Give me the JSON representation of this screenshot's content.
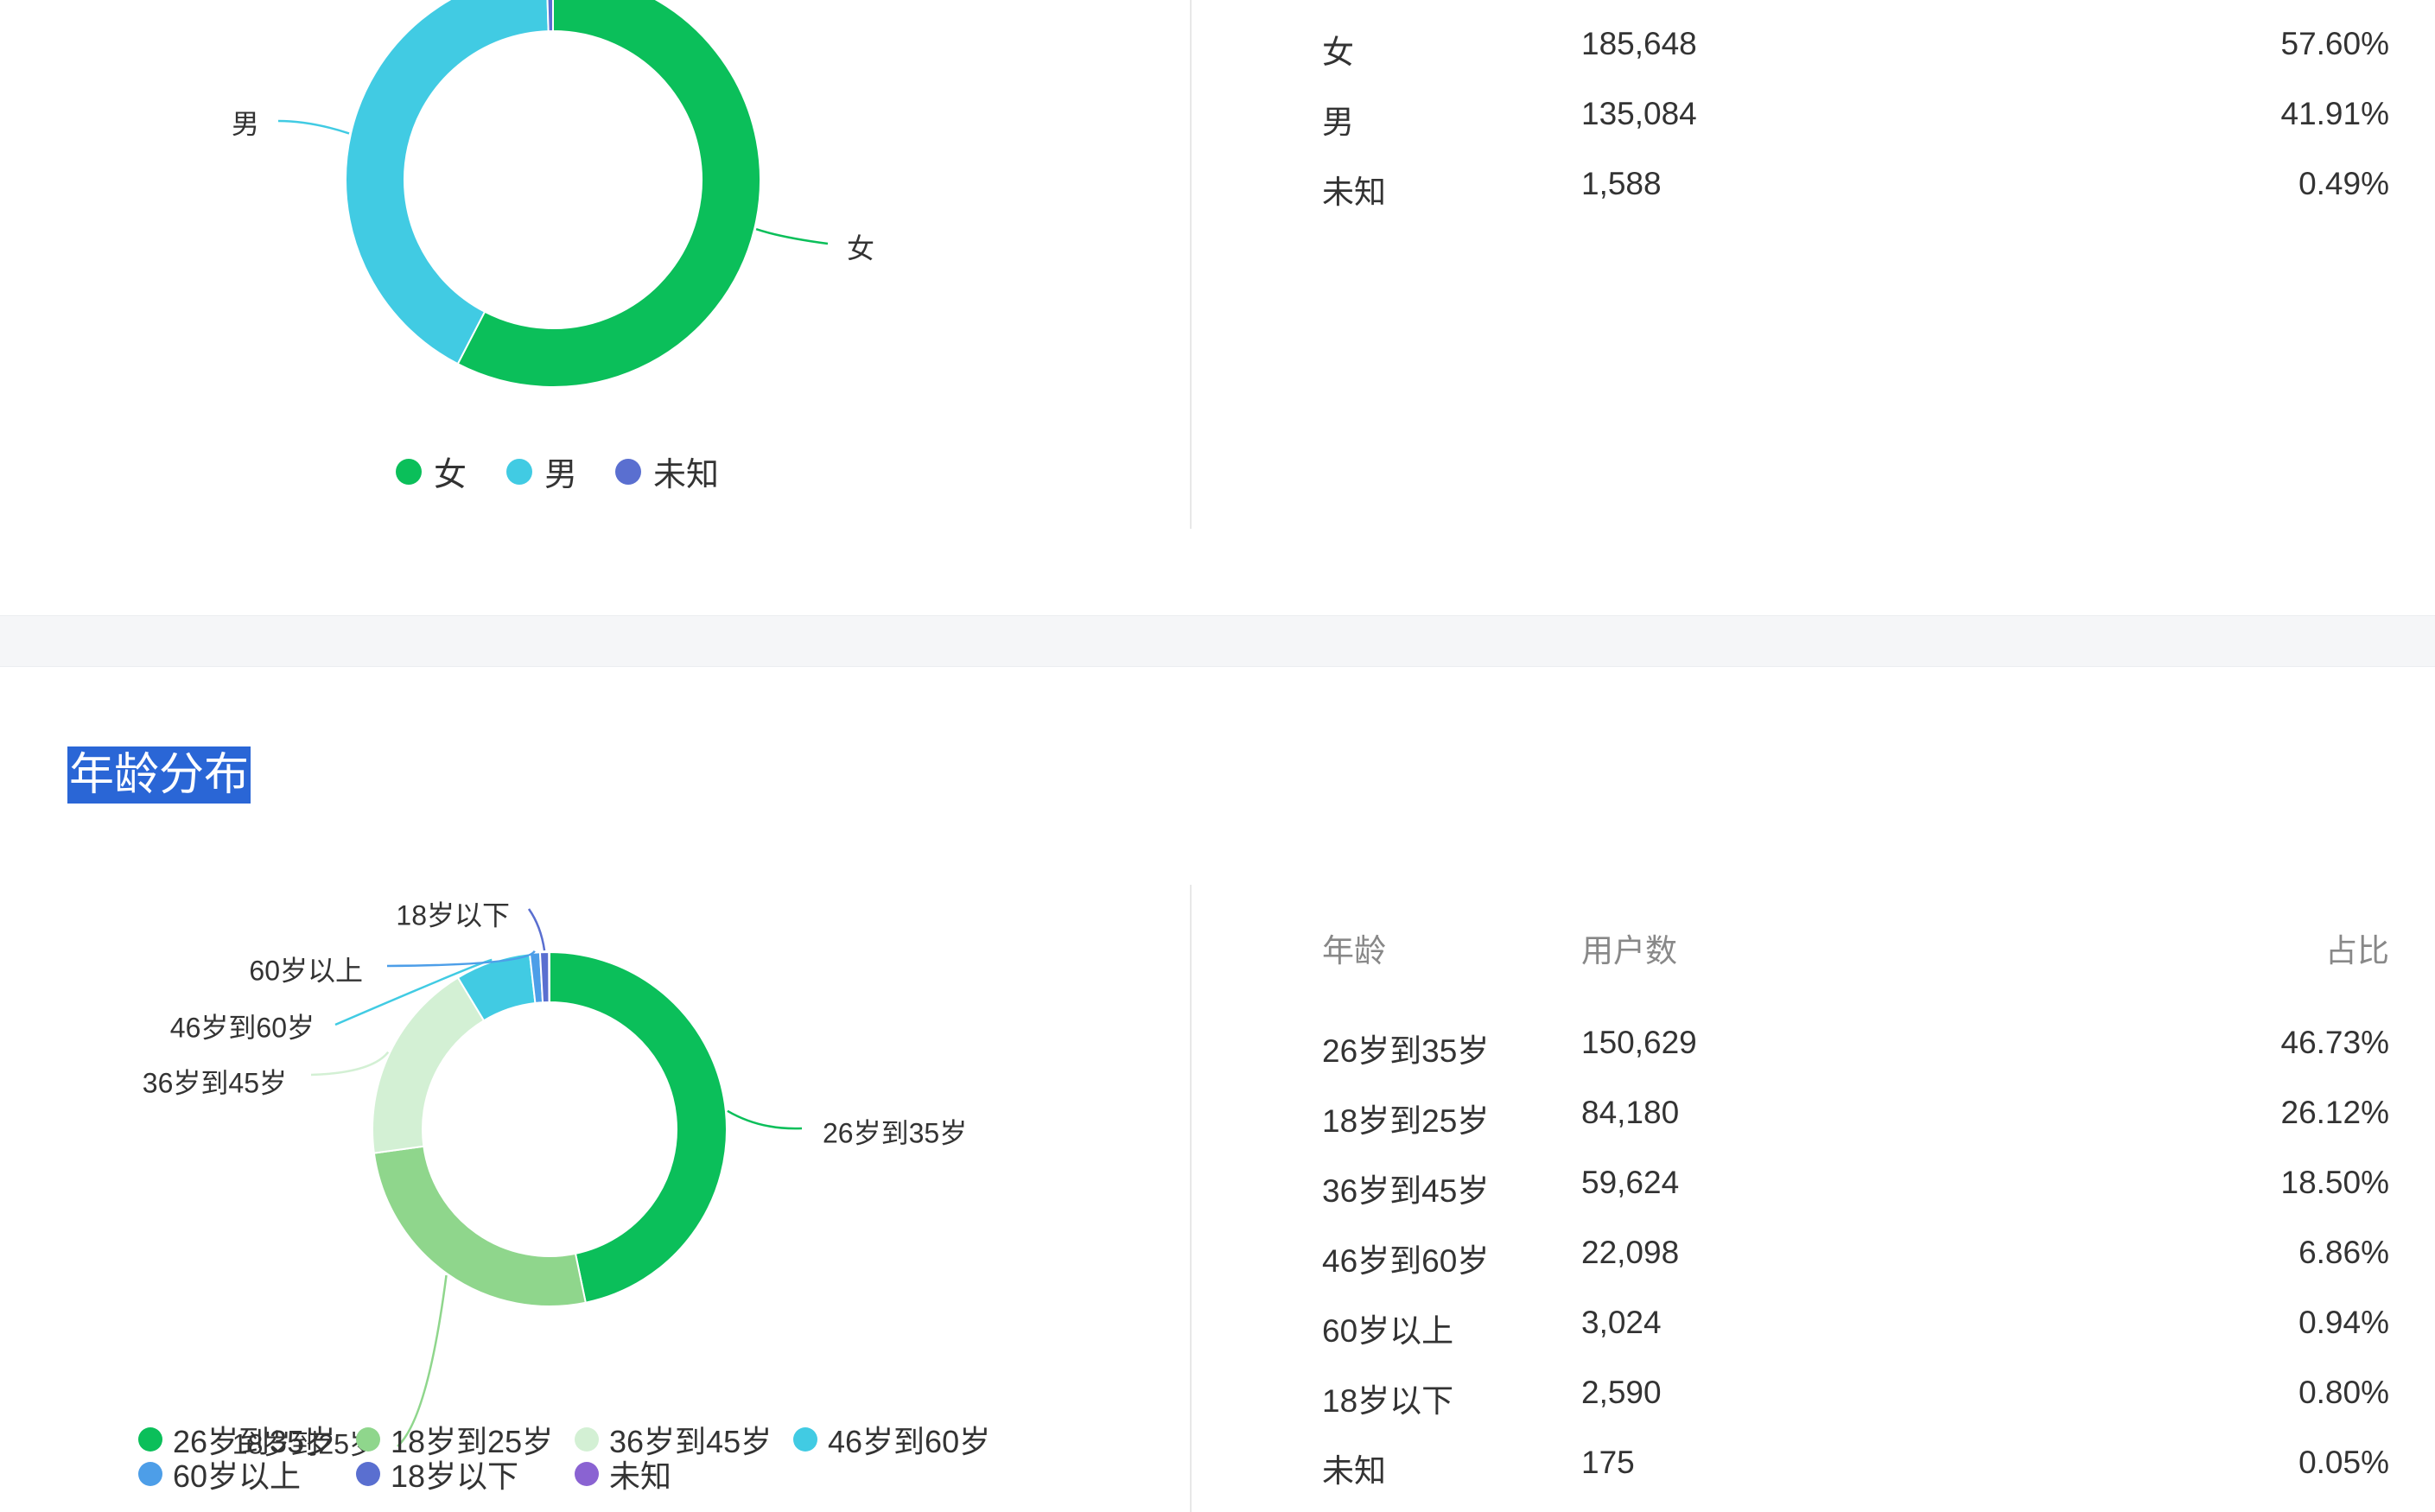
{
  "colors": {
    "green": "#0bbf5a",
    "light_green": "#8fd68c",
    "pale_green": "#d3f0d4",
    "cyan": "#41cbe3",
    "blue": "#4d9ee8",
    "indigo": "#5a6fd0",
    "purple": "#8a63d2",
    "highlight": "#2a66d6"
  },
  "gender": {
    "legend": [
      "女",
      "男",
      "未知"
    ],
    "rows": [
      {
        "label": "女",
        "count": "185,648",
        "pct": "57.60%"
      },
      {
        "label": "男",
        "count": "135,084",
        "pct": "41.91%"
      },
      {
        "label": "未知",
        "count": "1,588",
        "pct": "0.49%"
      }
    ]
  },
  "age": {
    "title": "年龄分布",
    "header": {
      "c1": "年龄",
      "c2": "用户数",
      "c3": "占比"
    },
    "rows": [
      {
        "label": "26岁到35岁",
        "count": "150,629",
        "pct": "46.73%"
      },
      {
        "label": "18岁到25岁",
        "count": "84,180",
        "pct": "26.12%"
      },
      {
        "label": "36岁到45岁",
        "count": "59,624",
        "pct": "18.50%"
      },
      {
        "label": "46岁到60岁",
        "count": "22,098",
        "pct": "6.86%"
      },
      {
        "label": "60岁以上",
        "count": "3,024",
        "pct": "0.94%"
      },
      {
        "label": "18岁以下",
        "count": "2,590",
        "pct": "0.80%"
      },
      {
        "label": "未知",
        "count": "175",
        "pct": "0.05%"
      }
    ]
  },
  "chart_data": [
    {
      "type": "pie",
      "categories": [
        "女",
        "男",
        "未知"
      ],
      "values": [
        185648,
        135084,
        1588
      ],
      "percentages": [
        57.6,
        41.91,
        0.49
      ],
      "donut": true,
      "legend": "bottom",
      "colors": [
        "#0bbf5a",
        "#41cbe3",
        "#5a6fd0"
      ]
    },
    {
      "type": "pie",
      "categories": [
        "26岁到35岁",
        "18岁到25岁",
        "36岁到45岁",
        "46岁到60岁",
        "60岁以上",
        "18岁以下",
        "未知"
      ],
      "values": [
        150629,
        84180,
        59624,
        22098,
        3024,
        2590,
        175
      ],
      "percentages": [
        46.73,
        26.12,
        18.5,
        6.86,
        0.94,
        0.8,
        0.05
      ],
      "donut": true,
      "legend": "bottom",
      "colors": [
        "#0bbf5a",
        "#8fd68c",
        "#d3f0d4",
        "#41cbe3",
        "#4d9ee8",
        "#5a6fd0",
        "#8a63d2"
      ]
    }
  ]
}
